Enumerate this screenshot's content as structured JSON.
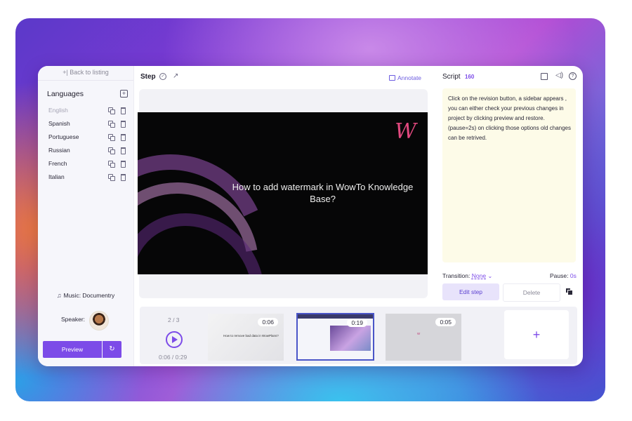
{
  "sidebar": {
    "back_label": "+| Back to listing",
    "languages_title": "Languages",
    "languages": [
      {
        "name": "English",
        "active": true
      },
      {
        "name": "Spanish"
      },
      {
        "name": "Portuguese"
      },
      {
        "name": "Russian"
      },
      {
        "name": "French"
      },
      {
        "name": "Italian"
      }
    ],
    "music_label": "Music: Documentry",
    "speaker_label": "Speaker:",
    "preview_label": "Preview",
    "refresh_icon": "↻"
  },
  "step": {
    "title": "Step",
    "annotate_label": "Annotate"
  },
  "video": {
    "title": "How to add watermark in WowTo Knowledge Base?",
    "logo": "W"
  },
  "script": {
    "title": "Script",
    "count": "160",
    "text": "Click on the revision button, a sidebar appears , you can either check your previous changes in project by clicking preview and restore. (pause=2s) on clicking those options old changes can be retrived.",
    "transition_label": "Transition:",
    "transition_value": "None",
    "pause_label": "Pause:",
    "pause_value": "0s",
    "edit_label": "Edit step",
    "delete_label": "Delete"
  },
  "timeline": {
    "counter": "2 / 3",
    "time": "0:06 / 0:29",
    "add_label": "+",
    "thumbnails": [
      {
        "duration": "0:06",
        "caption": "How to remove bad data in WowPlans?",
        "selected": false
      },
      {
        "duration": "0:19",
        "selected": true
      },
      {
        "duration": "0:05",
        "selected": false
      }
    ]
  },
  "colors": {
    "accent": "#7c4be8",
    "script_bg": "#fdfbe8",
    "logo": "#e0487e"
  },
  "icons": [
    "add-icon",
    "copy-icon",
    "trash-icon",
    "music-icon",
    "check-icon",
    "external-link-icon",
    "annotate-icon",
    "translate-icon",
    "volume-icon",
    "help-icon",
    "duplicate-icon",
    "play-icon",
    "refresh-icon"
  ]
}
